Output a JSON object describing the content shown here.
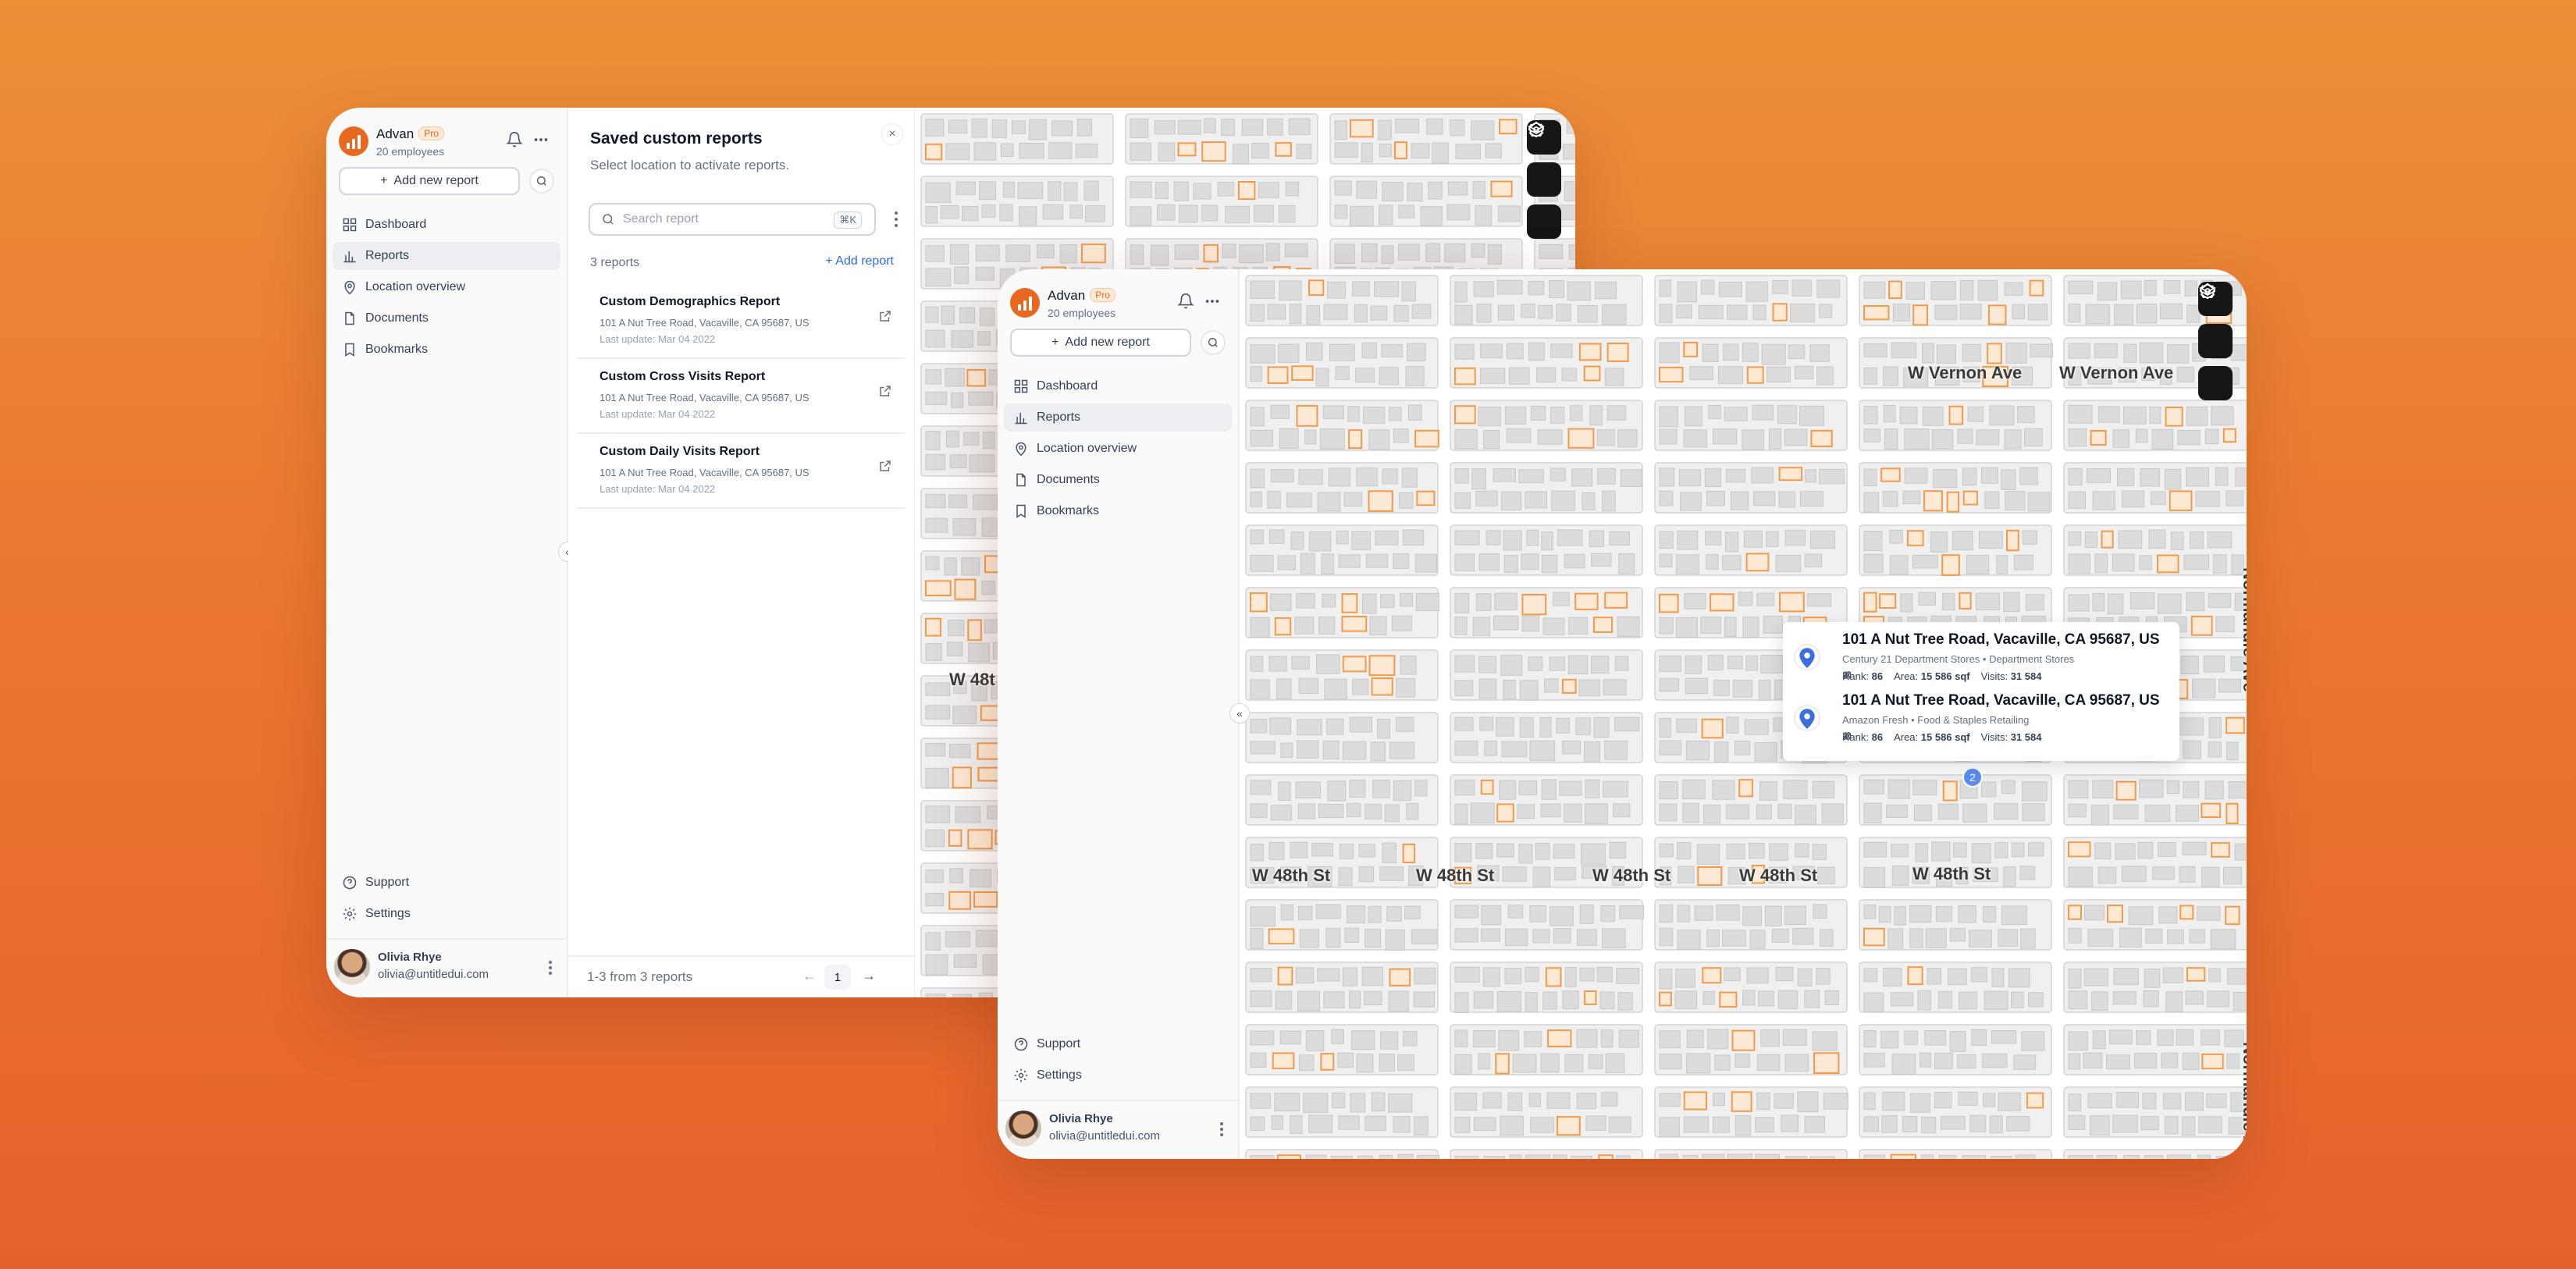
{
  "app": {
    "brand": "Advan",
    "plan_badge": "Pro",
    "subtitle": "20 employees",
    "add_report_label": "Add new report",
    "nav": [
      {
        "label": "Dashboard",
        "icon": "grid-icon"
      },
      {
        "label": "Reports",
        "icon": "bar-chart-icon"
      },
      {
        "label": "Location overview",
        "icon": "map-pin-icon"
      },
      {
        "label": "Documents",
        "icon": "file-icon"
      },
      {
        "label": "Bookmarks",
        "icon": "bookmark-icon"
      }
    ],
    "nav_active": "Reports",
    "bottom_nav": [
      {
        "label": "Support",
        "icon": "help-circle-icon"
      },
      {
        "label": "Settings",
        "icon": "gear-icon"
      }
    ],
    "user": {
      "name": "Olivia Rhye",
      "email": "olivia@untitledui.com"
    }
  },
  "reports_panel": {
    "title": "Saved custom reports",
    "subtitle": "Select location to activate reports.",
    "search_placeholder": "Search report",
    "shortcut": "⌘K",
    "count_label": "3 reports",
    "add_link": "+ Add report",
    "reports": [
      {
        "title": "Custom Demographics Report",
        "address": "101 A Nut Tree Road, Vacaville, CA 95687, US",
        "updated": "Last update: Mar 04 2022"
      },
      {
        "title": "Custom Cross Visits Report",
        "address": "101 A Nut Tree Road, Vacaville, CA 95687, US",
        "updated": "Last update: Mar 04 2022"
      },
      {
        "title": "Custom Daily Visits Report",
        "address": "101 A Nut Tree Road, Vacaville, CA 95687, US",
        "updated": "Last update: Mar 04 2022"
      }
    ],
    "pagination": {
      "summary": "1-3 from 3 reports",
      "current_page": "1"
    }
  },
  "map": {
    "street_labels": {
      "vernon_1": "W Vernon Ave",
      "vernon_2": "W Vernon Ave",
      "w48_1": "W 48th St",
      "w48_2": "W 48th St",
      "w48_3": "W 48th St",
      "w48_4": "W 48th St",
      "w48_5": "W 48th St",
      "w48_partial": "W 48t",
      "normandie_1": "Normandie Ave",
      "normandie_2": "Normandie Ave"
    },
    "cluster_count": "2",
    "popup": [
      {
        "title": "101 A Nut Tree Road, Vacaville, CA 95687, US",
        "category": "Century 21 Department Stores • Department Stores",
        "rank_label": "Rank:",
        "rank": "86",
        "area_label": "Area:",
        "area": "15 586 sqf",
        "visits_label": "Visits:",
        "visits": "31 584"
      },
      {
        "title": "101 A Nut Tree Road, Vacaville, CA 95687, US",
        "category": "Amazon Fresh • Food & Staples Retailing",
        "rank_label": "Rank:",
        "rank": "86",
        "area_label": "Area:",
        "area": "15 586 sqf",
        "visits_label": "Visits:",
        "visits": "31 584"
      }
    ],
    "controls": [
      "layers-icon",
      "polygon-icon",
      "gear-icon"
    ]
  },
  "colors": {
    "accent": "#e8681f",
    "link": "#2e6bea",
    "building_highlight": "#f29a4a",
    "building_default": "#dcdcdc",
    "road": "#ffffff"
  }
}
